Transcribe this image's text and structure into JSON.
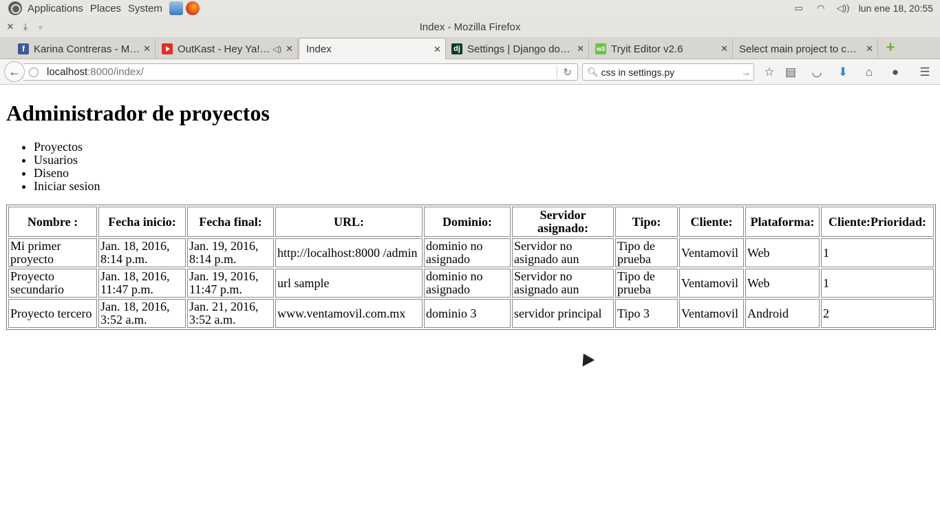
{
  "system_panel": {
    "menus": [
      "Applications",
      "Places",
      "System"
    ],
    "clock": "lun ene 18, 20:55"
  },
  "window": {
    "title": "Index - Mozilla Firefox"
  },
  "tabs": [
    {
      "label": "Karina Contreras - M…",
      "icon": "facebook-icon",
      "active": false
    },
    {
      "label": "OutKast - Hey Ya!…",
      "icon": "youtube-icon",
      "active": false,
      "audio": true
    },
    {
      "label": "Index",
      "icon": "",
      "active": true
    },
    {
      "label": "Settings | Django do…",
      "icon": "django-icon",
      "active": false
    },
    {
      "label": "Tryit Editor v2.6",
      "icon": "w3schools-icon",
      "active": false
    },
    {
      "label": "Select main project to c…",
      "icon": "",
      "active": false
    }
  ],
  "navbar": {
    "url_host": "localhost",
    "url_rest": ":8000/index/",
    "search_value": "css in settings.py"
  },
  "page": {
    "heading": "Administrador de proyectos",
    "nav_links": [
      "Proyectos",
      "Usuarios",
      "Diseno",
      "Iniciar sesion"
    ],
    "table": {
      "headers": [
        "Nombre :",
        "Fecha inicio:",
        "Fecha final:",
        "URL:",
        "Dominio:",
        "Servidor asignado:",
        "Tipo:",
        "Cliente:",
        "Plataforma:",
        "Cliente:Prioridad:"
      ],
      "rows": [
        [
          "Mi primer proyecto",
          "Jan. 18, 2016, 8:14 p.m.",
          "Jan. 19, 2016, 8:14 p.m.",
          "http://localhost:8000 /admin",
          "dominio no asignado",
          "Servidor no asignado aun",
          "Tipo de prueba",
          "Ventamovil",
          "Web",
          "1"
        ],
        [
          "Proyecto secundario",
          "Jan. 18, 2016, 11:47 p.m.",
          "Jan. 19, 2016, 11:47 p.m.",
          "url sample",
          "dominio no asignado",
          "Servidor no asignado aun",
          "Tipo de prueba",
          "Ventamovil",
          "Web",
          "1"
        ],
        [
          "Proyecto tercero",
          "Jan. 18, 2016, 3:52 a.m.",
          "Jan. 21, 2016, 3:52 a.m.",
          "www.ventamovil.com.mx",
          "dominio 3",
          "servidor principal",
          "Tipo 3",
          "Ventamovil",
          "Android",
          "2"
        ]
      ]
    }
  }
}
